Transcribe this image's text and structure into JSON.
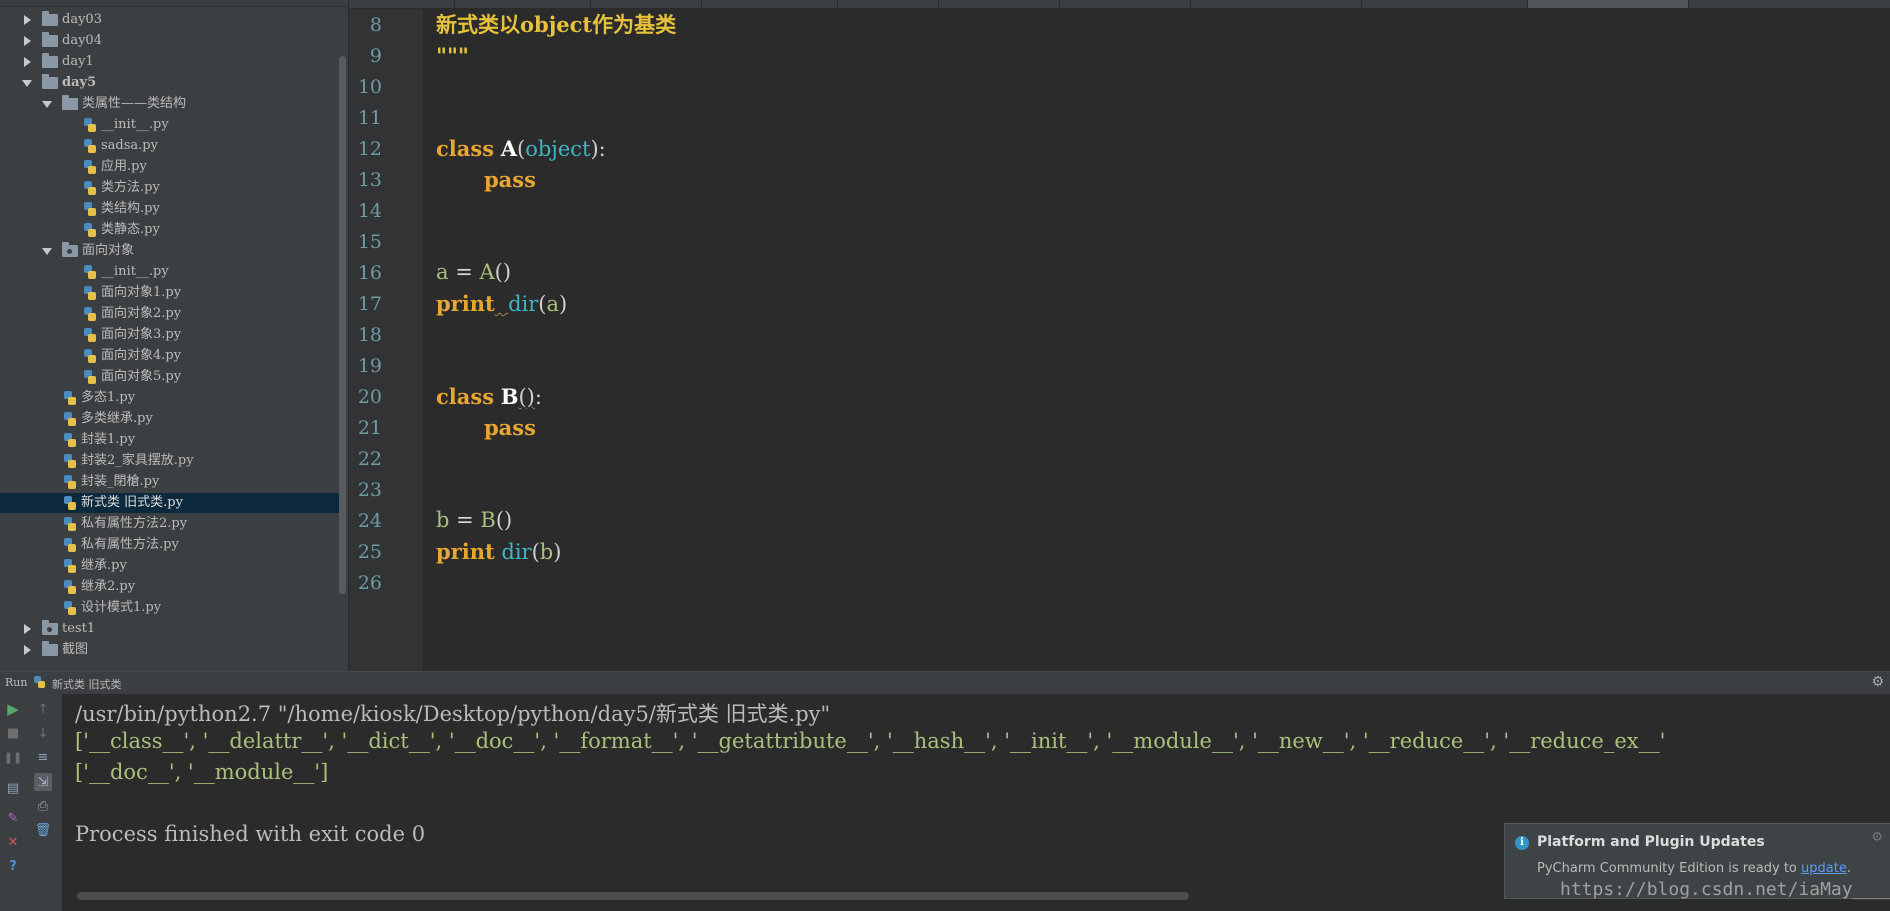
{
  "project_tree": {
    "items": [
      {
        "label": "day03",
        "depth": 0,
        "kind": "folder",
        "state": "collapsed"
      },
      {
        "label": "day04",
        "depth": 0,
        "kind": "folder",
        "state": "collapsed"
      },
      {
        "label": "day1",
        "depth": 0,
        "kind": "folder",
        "state": "collapsed"
      },
      {
        "label": "day5",
        "depth": 0,
        "kind": "folder",
        "state": "expanded",
        "bold": true
      },
      {
        "label": "类属性——类结构",
        "depth": 1,
        "kind": "folder",
        "state": "expanded"
      },
      {
        "label": "__init__.py",
        "depth": 2,
        "kind": "file"
      },
      {
        "label": "sadsa.py",
        "depth": 2,
        "kind": "file"
      },
      {
        "label": "应用.py",
        "depth": 2,
        "kind": "file"
      },
      {
        "label": "类方法.py",
        "depth": 2,
        "kind": "file"
      },
      {
        "label": "类结构.py",
        "depth": 2,
        "kind": "file"
      },
      {
        "label": "类静态.py",
        "depth": 2,
        "kind": "file"
      },
      {
        "label": "面向对象",
        "depth": 1,
        "kind": "package",
        "state": "expanded"
      },
      {
        "label": "__init__.py",
        "depth": 2,
        "kind": "file"
      },
      {
        "label": "面向对象1.py",
        "depth": 2,
        "kind": "file"
      },
      {
        "label": "面向对象2.py",
        "depth": 2,
        "kind": "file"
      },
      {
        "label": "面向对象3.py",
        "depth": 2,
        "kind": "file"
      },
      {
        "label": "面向对象4.py",
        "depth": 2,
        "kind": "file"
      },
      {
        "label": "面向对象5.py",
        "depth": 2,
        "kind": "file"
      },
      {
        "label": "多态1.py",
        "depth": 1,
        "kind": "file"
      },
      {
        "label": "多类继承.py",
        "depth": 1,
        "kind": "file"
      },
      {
        "label": "封装1.py",
        "depth": 1,
        "kind": "file"
      },
      {
        "label": "封装2_家具摆放.py",
        "depth": 1,
        "kind": "file"
      },
      {
        "label": "封装_閉槍.py",
        "depth": 1,
        "kind": "file"
      },
      {
        "label": "新式类 旧式类.py",
        "depth": 1,
        "kind": "file",
        "selected": true
      },
      {
        "label": "私有属性方法2.py",
        "depth": 1,
        "kind": "file"
      },
      {
        "label": "私有属性方法.py",
        "depth": 1,
        "kind": "file"
      },
      {
        "label": "继承.py",
        "depth": 1,
        "kind": "file"
      },
      {
        "label": "继承2.py",
        "depth": 1,
        "kind": "file"
      },
      {
        "label": "设计模式1.py",
        "depth": 1,
        "kind": "file"
      },
      {
        "label": "test1",
        "depth": 0,
        "kind": "package",
        "state": "collapsed"
      },
      {
        "label": "截图",
        "depth": 0,
        "kind": "folder",
        "state": "collapsed"
      }
    ]
  },
  "editor": {
    "line_numbers": [
      "8",
      "9",
      "10",
      "11",
      "12",
      "13",
      "14",
      "15",
      "16",
      "17",
      "18",
      "19",
      "20",
      "21",
      "22",
      "23",
      "24",
      "25",
      "26"
    ],
    "lines": {
      "l8": "新式类以object作为基类",
      "l9": "\"\"\"",
      "l12": {
        "kw": "class",
        "name": "A",
        "open": "(",
        "base": "object",
        "close": "):"
      },
      "l13": {
        "kw": "pass"
      },
      "l16": {
        "var": "a",
        "eq": " = ",
        "call": "A",
        "paren": "()"
      },
      "l17": {
        "kw": "print",
        "fn": "dir",
        "open": "(",
        "arg": "a",
        "close": ")"
      },
      "l20": {
        "kw": "class",
        "name": "B",
        "paren": "()",
        "colon": ":"
      },
      "l21": {
        "kw": "pass"
      },
      "l24": {
        "var": "b",
        "eq": " = ",
        "call": "B",
        "paren": "()"
      },
      "l25": {
        "kw": "print",
        "fn": "dir",
        "open": "(",
        "arg": "b",
        "close": ")"
      }
    }
  },
  "run_panel": {
    "title": "Run",
    "config_name": "新式类 旧式类",
    "console": [
      "/usr/bin/python2.7 \"/home/kiosk/Desktop/python/day5/新式类 旧式类.py\"",
      "['__class__', '__delattr__', '__dict__', '__doc__', '__format__', '__getattribute__', '__hash__', '__init__', '__module__', '__new__', '__reduce__', '__reduce_ex__'",
      "['__doc__', '__module__']",
      "",
      "Process finished with exit code 0"
    ]
  },
  "notification": {
    "title": "Platform and Plugin Updates",
    "text": "PyCharm Community Edition is ready to ",
    "link": "update",
    "text_end": "."
  },
  "watermark": "https://blog.csdn.net/iaMay_____",
  "colors": {
    "keyword": "#e6a830",
    "builtin": "#3fb5c4",
    "docstring": "#e6c13b",
    "variable": "#a9c17c",
    "background": "#2b2b2b",
    "panel": "#3c3f41"
  }
}
